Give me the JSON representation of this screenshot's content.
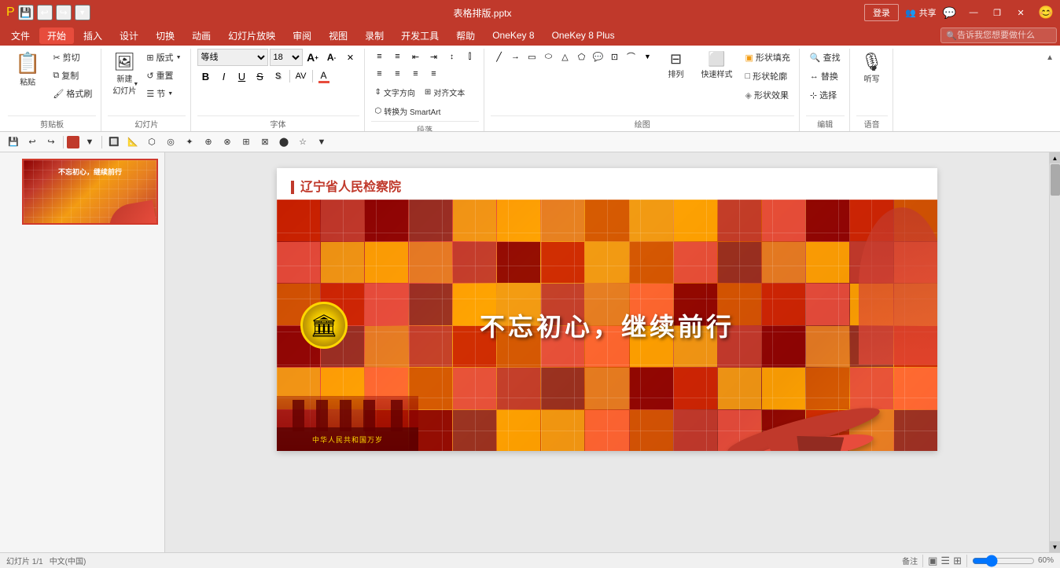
{
  "titlebar": {
    "filename": "表格排版.pptx",
    "login_btn": "登录",
    "win_minimize": "—",
    "win_restore": "❐",
    "win_close": "✕",
    "share_icon": "👥",
    "share_label": "共享"
  },
  "menubar": {
    "items": [
      {
        "id": "file",
        "label": "文件"
      },
      {
        "id": "home",
        "label": "开始",
        "active": true
      },
      {
        "id": "insert",
        "label": "插入"
      },
      {
        "id": "design",
        "label": "设计"
      },
      {
        "id": "transitions",
        "label": "切换"
      },
      {
        "id": "animations",
        "label": "动画"
      },
      {
        "id": "slideshow",
        "label": "幻灯片放映"
      },
      {
        "id": "review",
        "label": "审阅"
      },
      {
        "id": "view",
        "label": "视图"
      },
      {
        "id": "record",
        "label": "录制"
      },
      {
        "id": "dev",
        "label": "开发工具"
      },
      {
        "id": "help",
        "label": "帮助"
      },
      {
        "id": "onekey8",
        "label": "OneKey 8"
      },
      {
        "id": "onekey8plus",
        "label": "OneKey 8 Plus"
      }
    ],
    "search_placeholder": "告诉我您想要做什么"
  },
  "ribbon": {
    "clipboard": {
      "label": "剪贴板",
      "paste": "粘贴",
      "cut": "剪切",
      "copy": "复制",
      "format_painter": "格式刷"
    },
    "slides": {
      "label": "幻灯片",
      "new_slide": "新建\n幻灯片",
      "layout": "版式",
      "reset": "重置",
      "section": "节"
    },
    "font": {
      "label": "字体",
      "font_name": "等线",
      "font_size": "18",
      "increase_font": "A",
      "decrease_font": "A",
      "clear_format": "清除",
      "bold": "B",
      "italic": "I",
      "underline": "U",
      "strikethrough": "S",
      "shadow": "S",
      "char_spacing": "A",
      "font_color": "A"
    },
    "paragraph": {
      "label": "段落",
      "bullets": "≡",
      "numbering": "≡",
      "indent_less": "←",
      "indent_more": "→",
      "text_direction": "文字方向",
      "align_text": "对齐文本",
      "convert_smartart": "转换为 SmartArt"
    },
    "drawing": {
      "label": "绘图",
      "sort": "排列",
      "quick_styles": "快速样式",
      "fill": "形状填充",
      "outline": "形状轮廓",
      "effect": "形状效果"
    },
    "editing": {
      "label": "编辑",
      "find": "查找",
      "replace": "替换",
      "select": "选择"
    },
    "voice": {
      "label": "语音",
      "dictation": "听写"
    }
  },
  "slide": {
    "number": "1",
    "title": "辽宁省人民检察院",
    "slogan": "不忘初心，继续前行",
    "thumb_label": "不忘初心，继续前行"
  },
  "formatbar": {
    "items": [
      "💾",
      "↩",
      "↪",
      "□",
      "📄",
      "🔲"
    ]
  },
  "statusbar": {
    "slide_info": "幻灯片 1/1",
    "lang": "中文(中国)",
    "notes": "备注",
    "view_normal": "▣",
    "view_outline": "☰",
    "view_slide": "⊞",
    "zoom": "60%"
  },
  "colors": {
    "accent": "#c0392b",
    "title_red": "#c0392b",
    "ribbon_bg": "#ffffff",
    "menu_bg": "#c0392b"
  }
}
